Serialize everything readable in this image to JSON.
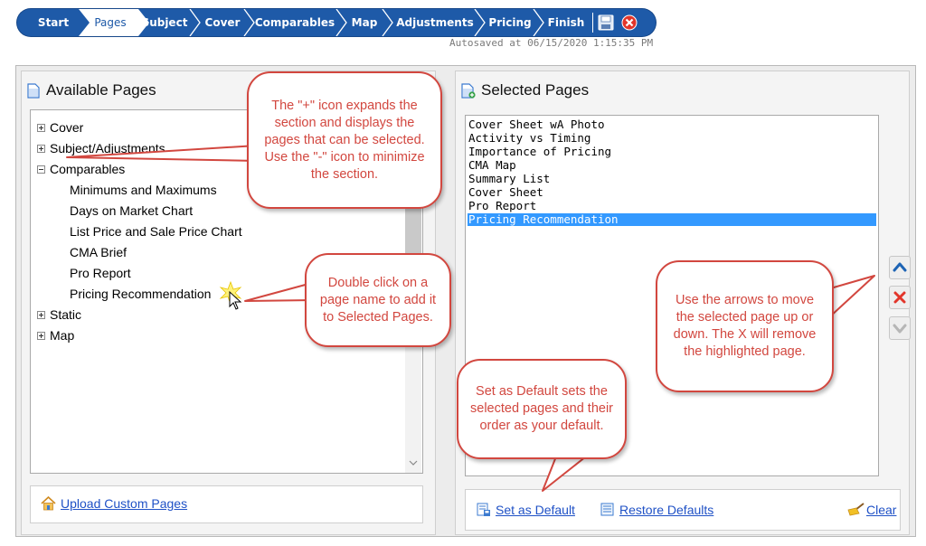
{
  "wizard": {
    "steps": [
      {
        "label": "Start"
      },
      {
        "label": "Pages"
      },
      {
        "label": "Subject"
      },
      {
        "label": "Cover"
      },
      {
        "label": "Comparables"
      },
      {
        "label": "Map"
      },
      {
        "label": "Adjustments"
      },
      {
        "label": "Pricing"
      },
      {
        "label": "Finish"
      }
    ],
    "active_step": "Pages",
    "autosave": "Autosaved at 06/15/2020 1:15:35 PM"
  },
  "available_pages": {
    "title": "Available Pages",
    "tree": [
      {
        "label": "Cover",
        "toggle": "plus"
      },
      {
        "label": "Subject/Adjustments",
        "toggle": "plus"
      },
      {
        "label": "Comparables",
        "toggle": "minus",
        "children": [
          "Minimums and Maximums",
          "Days on Market Chart",
          "List Price and Sale Price Chart",
          "CMA Brief",
          "Pro Report",
          "Pricing Recommendation"
        ]
      },
      {
        "label": "Static",
        "toggle": "plus"
      },
      {
        "label": "Map",
        "toggle": "plus"
      }
    ],
    "upload_link": "Upload Custom Pages"
  },
  "selected_pages": {
    "title": "Selected Pages",
    "items": [
      "Cover Sheet wA Photo",
      "Activity vs Timing",
      "Importance of Pricing",
      "CMA Map",
      "Summary List",
      "Cover Sheet",
      "Pro Report",
      "Pricing Recommendation"
    ],
    "highlighted_index": 7,
    "footer": {
      "set_default": "Set as Default",
      "restore_defaults": "Restore Defaults",
      "clear": "Clear"
    }
  },
  "callouts": {
    "expand": "The \"+\" icon expands the section and displays the pages that can be selected.  Use the \"-\" icon to minimize the section.",
    "double_click": "Double click on a page name to add it to Selected Pages.",
    "arrows": "Use the arrows to move the selected page up or down. The X will remove the highlighted page.",
    "default": "Set as Default sets the selected pages and their order as your default."
  },
  "colors": {
    "wizard_blue": "#1e5aa8",
    "callout_red": "#d2473f",
    "selection_blue": "#3399ff",
    "link_blue": "#1f51c6"
  },
  "icons": {
    "save": "floppy-disk-icon",
    "close": "close-circle-icon",
    "page": "page-icon",
    "page_add": "page-add-icon",
    "upload": "home-upload-icon",
    "set_default": "save-list-icon",
    "restore": "restore-list-icon",
    "clear": "broom-icon",
    "move_up": "arrow-up-icon",
    "remove": "x-icon",
    "move_down": "arrow-down-icon"
  }
}
